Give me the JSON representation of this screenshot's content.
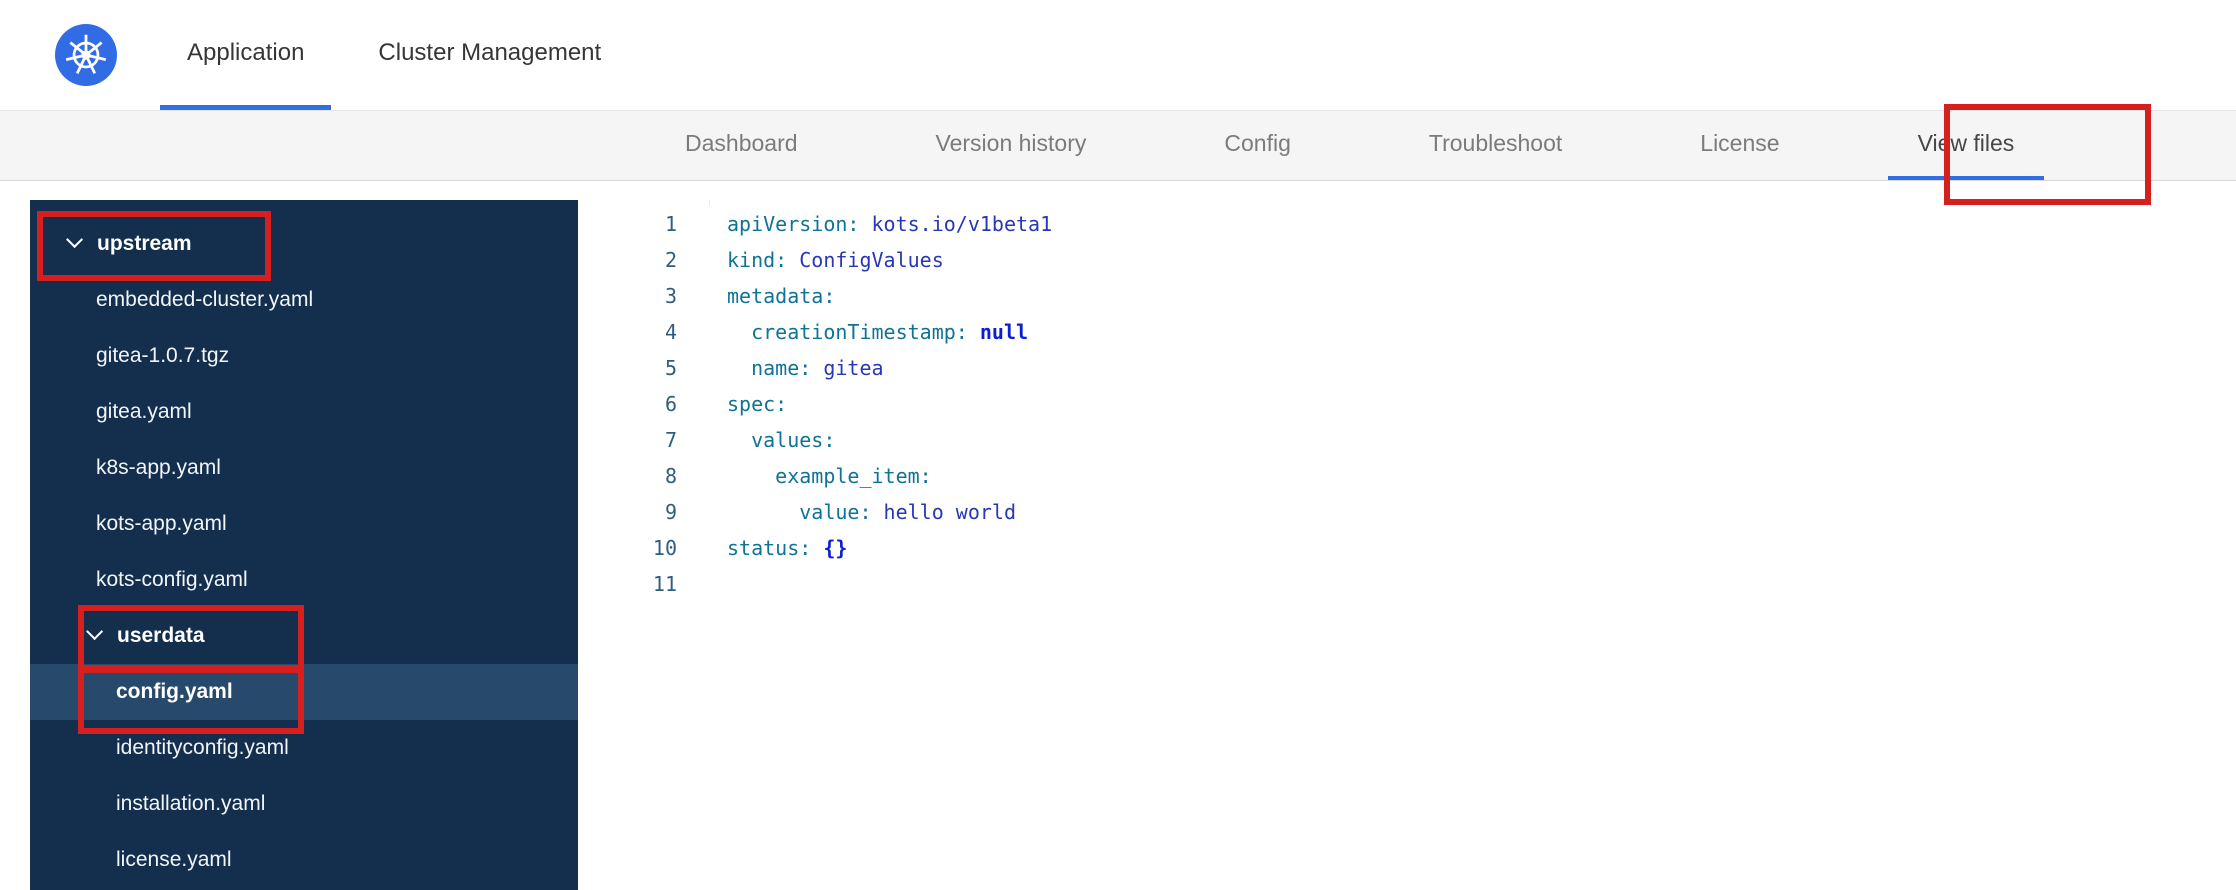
{
  "colors": {
    "accent_blue": "#326de6",
    "annotation_red": "#d6201f",
    "sidebar_bg": "#132f4d",
    "sidebar_selected_bg": "#27496b",
    "code_key": "#0f7396",
    "code_value": "#2737b8",
    "code_keyword": "#0a1fd0"
  },
  "header": {
    "logo_icon": "kubernetes-helm-wheel",
    "tabs": [
      {
        "label": "Application",
        "active": true
      },
      {
        "label": "Cluster Management",
        "active": false
      }
    ]
  },
  "subnav": {
    "tabs": [
      {
        "label": "Dashboard",
        "active": false
      },
      {
        "label": "Version history",
        "active": false
      },
      {
        "label": "Config",
        "active": false
      },
      {
        "label": "Troubleshoot",
        "active": false
      },
      {
        "label": "License",
        "active": false
      },
      {
        "label": "View files",
        "active": true,
        "annotated": true
      }
    ]
  },
  "file_tree": {
    "items": [
      {
        "label": "upstream",
        "type": "folder",
        "expanded": true,
        "annotated": true
      },
      {
        "label": "embedded-cluster.yaml",
        "type": "file"
      },
      {
        "label": "gitea-1.0.7.tgz",
        "type": "file"
      },
      {
        "label": "gitea.yaml",
        "type": "file"
      },
      {
        "label": "k8s-app.yaml",
        "type": "file"
      },
      {
        "label": "kots-app.yaml",
        "type": "file"
      },
      {
        "label": "kots-config.yaml",
        "type": "file"
      },
      {
        "label": "userdata",
        "type": "folder",
        "expanded": true,
        "annotated": true
      },
      {
        "label": "config.yaml",
        "type": "file",
        "selected": true,
        "annotated": true
      },
      {
        "label": "identityconfig.yaml",
        "type": "file"
      },
      {
        "label": "installation.yaml",
        "type": "file"
      },
      {
        "label": "license.yaml",
        "type": "file"
      }
    ]
  },
  "editor": {
    "language": "yaml",
    "lines": [
      {
        "num": "1",
        "key": "apiVersion:",
        "value": " kots.io/v1beta1"
      },
      {
        "num": "2",
        "key": "kind:",
        "value": " ConfigValues"
      },
      {
        "num": "3",
        "key": "metadata:",
        "value": ""
      },
      {
        "num": "4",
        "key": "  creationTimestamp:",
        "value": " null"
      },
      {
        "num": "5",
        "key": "  name:",
        "value": " gitea"
      },
      {
        "num": "6",
        "key": "spec:",
        "value": ""
      },
      {
        "num": "7",
        "key": "  values:",
        "value": ""
      },
      {
        "num": "8",
        "key": "    example_item:",
        "value": ""
      },
      {
        "num": "9",
        "key": "      value:",
        "value": " hello world"
      },
      {
        "num": "10",
        "key": "status:",
        "value": " {}"
      },
      {
        "num": "11",
        "key": "",
        "value": ""
      }
    ]
  }
}
